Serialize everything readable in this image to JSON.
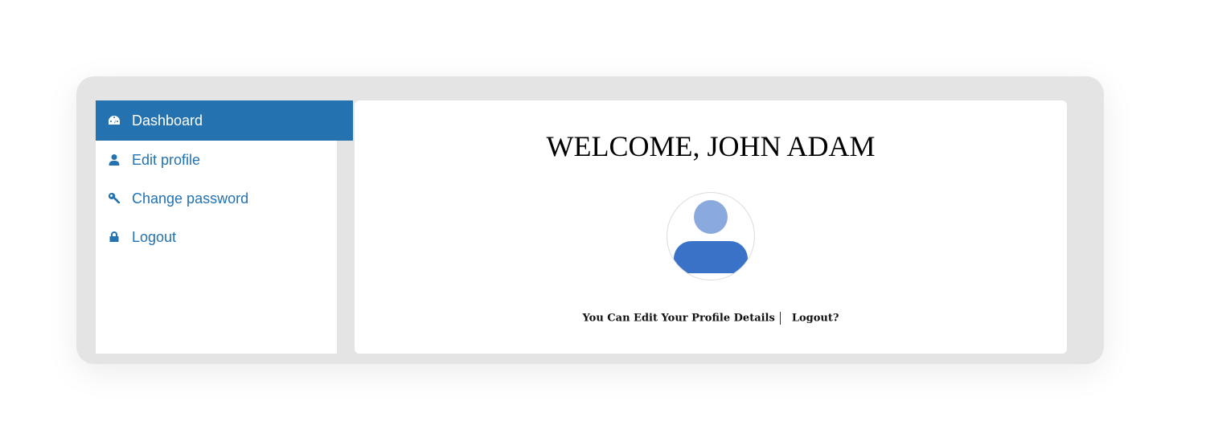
{
  "sidebar": {
    "items": [
      {
        "label": "Dashboard",
        "icon": "dashboard-icon",
        "active": true
      },
      {
        "label": "Edit profile",
        "icon": "user-icon",
        "active": false
      },
      {
        "label": "Change password",
        "icon": "key-icon",
        "active": false
      },
      {
        "label": "Logout",
        "icon": "lock-icon",
        "active": false
      }
    ]
  },
  "main": {
    "welcome_text": "WELCOME, JOHN ADAM",
    "edit_details_text": "You Can Edit Your Profile Details",
    "logout_link": "Logout?"
  },
  "colors": {
    "accent": "#2472b0",
    "avatar_head": "#8aaade",
    "avatar_body": "#3a72c8"
  }
}
